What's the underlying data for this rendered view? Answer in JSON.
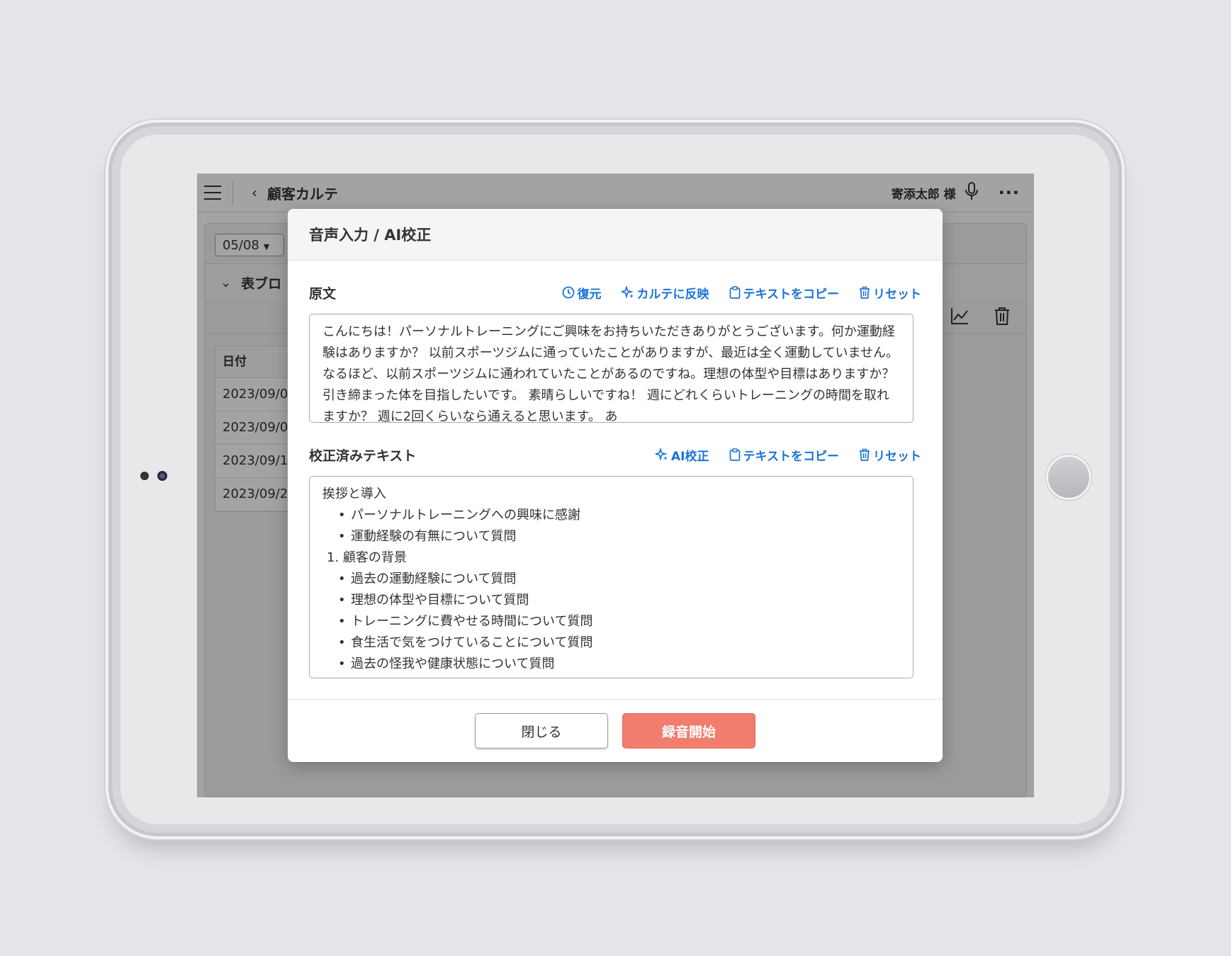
{
  "app": {
    "title": "顧客カルテ",
    "customer_name": "寄添太郎 様",
    "date_selected": "05/08",
    "section_label": "表ブロ",
    "table": {
      "header": "日付",
      "rows": [
        "2023/09/0",
        "2023/09/0",
        "2023/09/1",
        "2023/09/2"
      ]
    }
  },
  "modal": {
    "title": "音声入力 / AI校正",
    "original": {
      "label": "原文",
      "actions": {
        "restore": "復元",
        "apply": "カルテに反映",
        "copy": "テキストをコピー",
        "reset": "リセット"
      },
      "text": "こんにちは！パーソナルトレーニングにご興味をお持ちいただきありがとうございます。何か運動経験はありますか？ 以前スポーツジムに通っていたことがありますが、最近は全く運動していません。 なるほど、以前スポーツジムに通われていたことがあるのですね。理想の体型や目標はありますか？引き締まった体を目指したいです。 素晴らしいですね！ 週にどれくらいトレーニングの時間を取れますか？ 週に2回くらいなら通えると思います。 あ"
    },
    "corrected": {
      "label": "校正済みテキスト",
      "actions": {
        "ai": "AI校正",
        "copy": "テキストをコピー",
        "reset": "リセット"
      },
      "heading": "挨拶と導入",
      "intro_items": [
        "パーソナルトレーニングへの興味に感謝",
        "運動経験の有無について質問"
      ],
      "section_number": "1.",
      "section_title": "顧客の背景",
      "section_items": [
        "過去の運動経験について質問",
        "理想の体型や目標について質問",
        "トレーニングに費やせる時間について質問",
        "食生活で気をつけていることについて質問",
        "過去の怪我や健康状態について質問"
      ]
    },
    "buttons": {
      "close": "閉じる",
      "record": "録音開始"
    }
  },
  "colors": {
    "accent": "#1a73d9",
    "record_button": "#f07d6d"
  }
}
